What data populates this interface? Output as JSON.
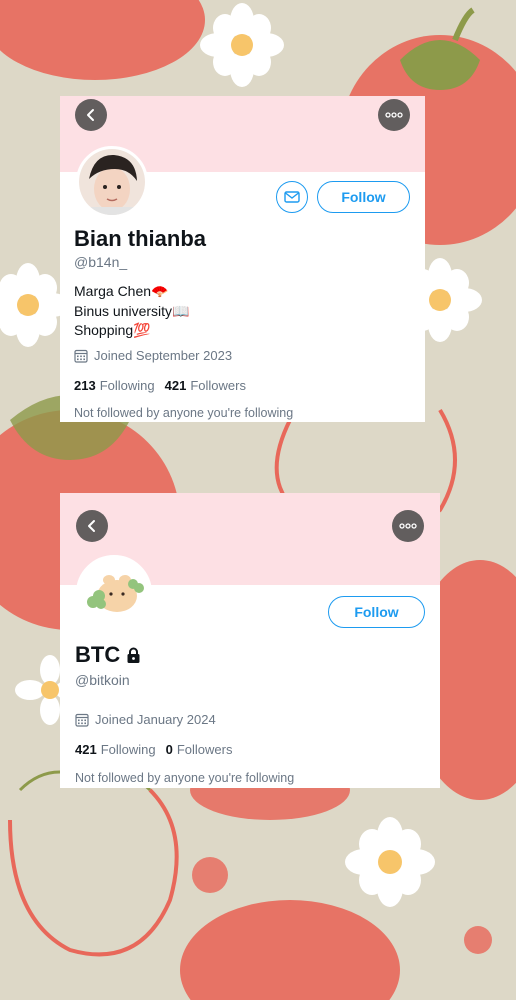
{
  "profiles": [
    {
      "display_name": "Bian thianba",
      "handle": "@b14n_",
      "bio_lines": [
        "Marga Chen🪭",
        "Binus university📖",
        "Shopping💯"
      ],
      "joined": "Joined September 2023",
      "following_count": "213",
      "following_label": "Following",
      "followers_count": "421",
      "followers_label": "Followers",
      "follow_label": "Follow",
      "not_followed_note": "Not followed by anyone you're following"
    },
    {
      "display_name": "BTC",
      "protected": true,
      "handle": "@bitkoin",
      "joined": "Joined January 2024",
      "following_count": "421",
      "following_label": "Following",
      "followers_count": "0",
      "followers_label": "Followers",
      "follow_label": "Follow",
      "not_followed_note": "Not followed by anyone you're following"
    }
  ],
  "colors": {
    "background": "#ddd8c7",
    "banner": "#fde0e4",
    "accent": "#1d9bf0",
    "strawberry": "#e8685a"
  },
  "icons": [
    "back-arrow-icon",
    "more-options-icon",
    "mail-icon",
    "calendar-icon",
    "lock-icon",
    "strawberry-icon",
    "daisy-icon"
  ]
}
